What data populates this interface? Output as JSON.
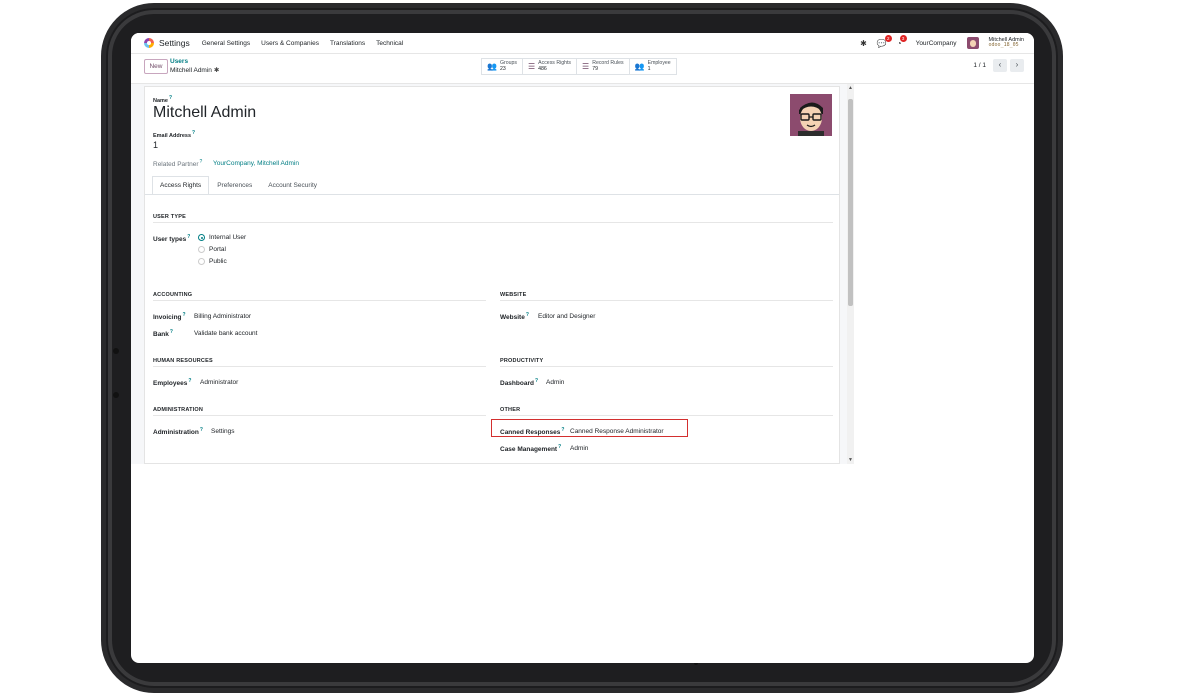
{
  "navbar": {
    "app_name": "Settings",
    "menu": [
      "General Settings",
      "Users & Companies",
      "Translations",
      "Technical"
    ],
    "chat_badge": "2",
    "activity_badge": "3",
    "company": "YourCompany",
    "user_name": "Mitchell Admin",
    "db_name": "odoo_18_05"
  },
  "control": {
    "new_label": "New",
    "breadcrumb_parent": "Users",
    "breadcrumb_current": "Mitchell Admin",
    "stats": [
      {
        "label": "Groups",
        "value": "23",
        "icon": "groups-icon"
      },
      {
        "label": "Access Rights",
        "value": "486",
        "icon": "list-icon"
      },
      {
        "label": "Record Rules",
        "value": "79",
        "icon": "list-icon"
      },
      {
        "label": "Employee",
        "value": "1",
        "icon": "employee-icon"
      }
    ],
    "pager": "1 / 1"
  },
  "form": {
    "name_label": "Name",
    "name_value": "Mitchell Admin",
    "email_label": "Email Address",
    "email_value": "1",
    "partner_label": "Related Partner",
    "partner_value": "YourCompany, Mitchell Admin",
    "tabs": [
      "Access Rights",
      "Preferences",
      "Account Security"
    ],
    "active_tab": "Access Rights",
    "user_type_head": "USER TYPE",
    "user_types_label": "User types",
    "user_type_options": [
      "Internal User",
      "Portal",
      "Public"
    ],
    "user_type_selected": "Internal User",
    "accounting_head": "ACCOUNTING",
    "invoicing_label": "Invoicing",
    "invoicing_value": "Billing Administrator",
    "bank_label": "Bank",
    "bank_value": "Validate bank account",
    "website_head": "WEBSITE",
    "website_label": "Website",
    "website_value": "Editor and Designer",
    "hr_head": "HUMAN RESOURCES",
    "employees_label": "Employees",
    "employees_value": "Administrator",
    "productivity_head": "PRODUCTIVITY",
    "dashboard_label": "Dashboard",
    "dashboard_value": "Admin",
    "administration_head": "ADMINISTRATION",
    "administration_label": "Administration",
    "administration_value": "Settings",
    "other_head": "OTHER",
    "canned_label": "Canned Responses",
    "canned_value": "Canned Response Administrator",
    "case_label": "Case Management",
    "case_value": "Admin"
  },
  "colors": {
    "accent": "#017e84",
    "brand": "#714b67",
    "highlight": "#d32f2f"
  }
}
